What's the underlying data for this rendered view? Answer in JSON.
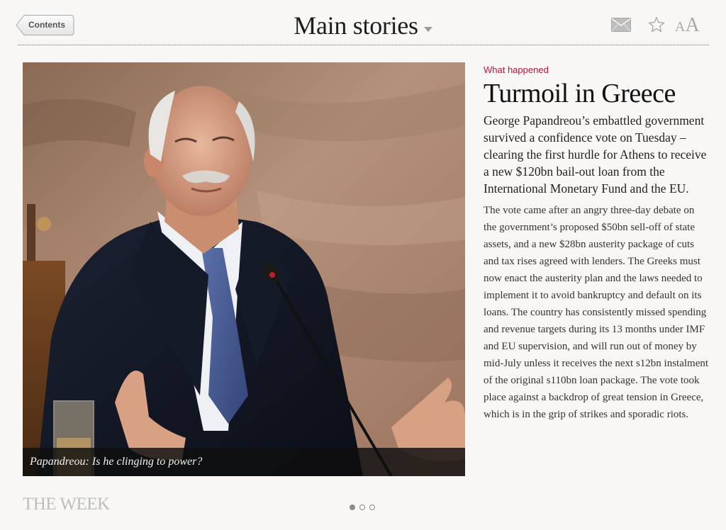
{
  "header": {
    "back_label": "Contents",
    "title": "Main stories",
    "icons": [
      "mail-icon",
      "star-icon",
      "text-size-icon"
    ],
    "text_size_small": "A",
    "text_size_big": "A"
  },
  "photo": {
    "caption": "Papandreou: Is he clinging to power?"
  },
  "article": {
    "kicker": "What happened",
    "headline": "Turmoil in Greece",
    "standfirst": "George Papandreou’s embattled government survived a confidence vote on Tuesday – clearing the first hurdle for Athens to receive a new $120bn bail-out loan from the International Monetary Fund and the EU.",
    "body": "The vote came after an angry three-day debate on the government’s proposed $50bn sell-off of state assets, and a new $28bn austerity package of cuts and tax rises agreed with lenders. The Greeks must now enact the austerity plan and the laws needed to implement it to avoid bankruptcy and default on its loans. The country has consistently missed spending and revenue targets during its 13 months under IMF and EU supervision, and will run out of money by mid-July unless it receives the next s12bn instalment of the original s110bn loan package. The vote took place against a backdrop of great tension in Greece, which is in the grip of strikes and sporadic riots."
  },
  "footer": {
    "brand": "THE WEEK",
    "pager": {
      "current": 1,
      "total": 3
    }
  },
  "colors": {
    "accent": "#c0123c",
    "background": "#f8f7f5"
  }
}
